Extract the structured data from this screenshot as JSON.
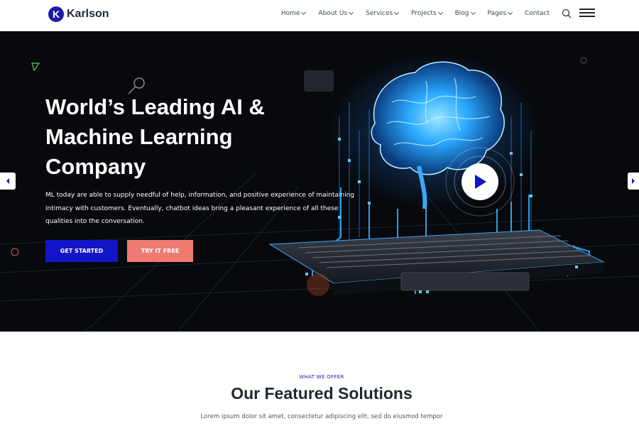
{
  "brand": {
    "logo_letter": "K",
    "name": "Karlson"
  },
  "nav": {
    "items": [
      {
        "label": "Home",
        "has_dropdown": true
      },
      {
        "label": "About Us",
        "has_dropdown": true
      },
      {
        "label": "Services",
        "has_dropdown": true
      },
      {
        "label": "Projects",
        "has_dropdown": true
      },
      {
        "label": "Blog",
        "has_dropdown": true
      },
      {
        "label": "Pages",
        "has_dropdown": true
      },
      {
        "label": "Contact",
        "has_dropdown": false
      }
    ],
    "icons": [
      "search-icon",
      "hamburger-menu-icon"
    ]
  },
  "hero": {
    "title_line1": "World’s Leading AI &",
    "title_line2": "Machine Learning",
    "title_line3": "Company",
    "description_line1": "ML today are able to supply needful of help, information, and positive experience of maintaining",
    "description_line2": "intimacy with customers. Eventually, chatbot ideas bring a pleasant experience of all these",
    "description_line3": "qualities into the conversation.",
    "primary_button": "GET STARTED",
    "secondary_button": "TRY IT FREE",
    "icons": [
      "chevron-left-icon",
      "chevron-right-icon",
      "play-icon"
    ]
  },
  "section": {
    "eyebrow": "WHAT WE OFFER",
    "title": "Our Featured Solutions",
    "text": "Lorem ipsum dolor sit amet, consectetur adipiscing elit, sed do eiusmod tempor"
  },
  "colors": {
    "brand_blue": "#1414c8",
    "coral": "#ef7a72",
    "hero_bg": "#07090d",
    "neon_blue": "#28b4ff",
    "heading_dark": "#1f2733"
  }
}
